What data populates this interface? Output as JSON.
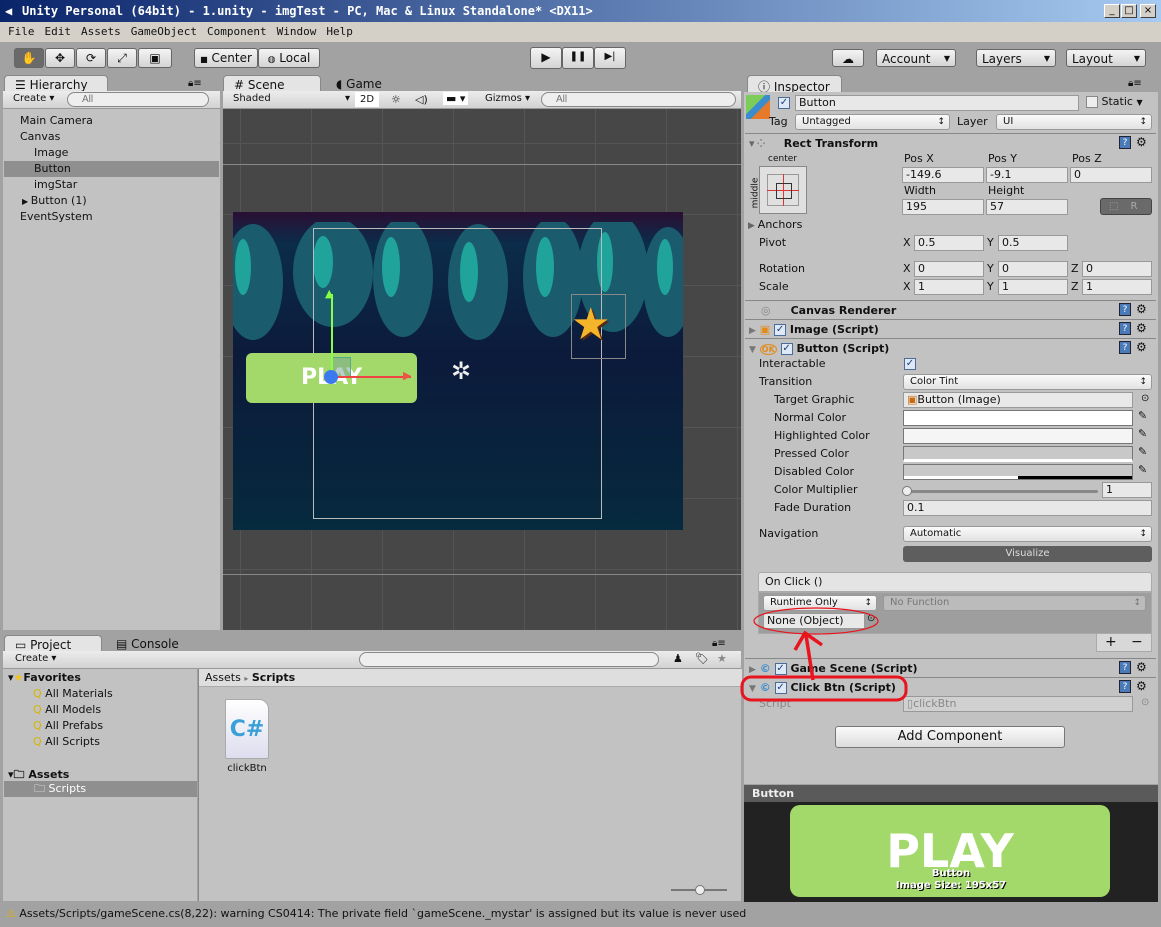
{
  "window": {
    "title": "Unity Personal (64bit) - 1.unity - imgTest - PC, Mac & Linux Standalone* <DX11>",
    "min": "_",
    "max": "□",
    "close": "×"
  },
  "menu": [
    "File",
    "Edit",
    "Assets",
    "GameObject",
    "Component",
    "Window",
    "Help"
  ],
  "toolbar": {
    "tools": [
      "hand-icon",
      "move-icon",
      "rotate-icon",
      "scale-icon",
      "rect-icon"
    ],
    "center": "Center",
    "local": "Local",
    "play": "▶",
    "pause": "❚❚",
    "step": "▶|",
    "cloud": "☁",
    "account": "Account",
    "layers": "Layers",
    "layout": "Layout"
  },
  "hierarchy": {
    "tab": "Hierarchy",
    "create": "Create",
    "search_placeholder": "All",
    "items": [
      {
        "label": "Main Camera",
        "indent": 0
      },
      {
        "label": "Canvas",
        "indent": 0
      },
      {
        "label": "Image",
        "indent": 1
      },
      {
        "label": "Button",
        "indent": 1,
        "selected": true
      },
      {
        "label": "imgStar",
        "indent": 1
      },
      {
        "label": "Button (1)",
        "indent": 1,
        "collapsed": true
      },
      {
        "label": "EventSystem",
        "indent": 0
      }
    ]
  },
  "scene": {
    "tab_scene": "Scene",
    "tab_game": "Game",
    "shading": "Shaded",
    "mode_2d": "2D",
    "gizmos": "Gizmos",
    "search_placeholder": "All",
    "play_text": "PLAY"
  },
  "project": {
    "tab_project": "Project",
    "tab_console": "Console",
    "create": "Create",
    "favorites": "Favorites",
    "fav_items": [
      "All Materials",
      "All Models",
      "All Prefabs",
      "All Scripts"
    ],
    "assets": "Assets",
    "folders": [
      "Scripts"
    ],
    "breadcrumb": [
      "Assets",
      "Scripts"
    ],
    "files": [
      {
        "name": "clickBtn",
        "type": "C#"
      }
    ]
  },
  "inspector": {
    "tab": "Inspector",
    "object_name": "Button",
    "static_label": "Static",
    "tag_label": "Tag",
    "tag": "Untagged",
    "layer_label": "Layer",
    "layer": "UI",
    "rect_transform": {
      "title": "Rect Transform",
      "anchor_h": "center",
      "anchor_v": "middle",
      "pos_x_label": "Pos X",
      "pos_y_label": "Pos Y",
      "pos_z_label": "Pos Z",
      "pos_x": "-149.6",
      "pos_y": "-9.1",
      "pos_z": "0",
      "width_label": "Width",
      "height_label": "Height",
      "width": "195",
      "height": "57",
      "r_label": "R",
      "anchors": "Anchors",
      "pivot": "Pivot",
      "pivot_x": "0.5",
      "pivot_y": "0.5",
      "rotation": "Rotation",
      "rot_x": "0",
      "rot_y": "0",
      "rot_z": "0",
      "scale": "Scale",
      "scale_x": "1",
      "scale_y": "1",
      "scale_z": "1",
      "x": "X",
      "y": "Y",
      "z": "Z"
    },
    "canvas_renderer": "Canvas Renderer",
    "image_script": "Image (Script)",
    "button_script": {
      "title": "Button (Script)",
      "interactable": "Interactable",
      "transition": "Transition",
      "transition_value": "Color Tint",
      "target_graphic": "Target Graphic",
      "target_graphic_value": "Button (Image)",
      "normal_color": "Normal Color",
      "highlighted_color": "Highlighted Color",
      "pressed_color": "Pressed Color",
      "disabled_color": "Disabled Color",
      "color_multiplier": "Color Multiplier",
      "color_multiplier_value": "1",
      "fade_duration": "Fade Duration",
      "fade_duration_value": "0.1",
      "navigation": "Navigation",
      "navigation_value": "Automatic",
      "visualize": "Visualize",
      "on_click": "On Click ()",
      "runtime": "Runtime Only",
      "function": "No Function",
      "object": "None (Object)",
      "plus": "+",
      "minus": "−"
    },
    "game_scene_script": "Game Scene (Script)",
    "click_btn_script": "Click Btn (Script)",
    "script_label": "Script",
    "script_value": "clickBtn",
    "add_component": "Add Component",
    "colors": {
      "normal": "#ffffff",
      "highlighted": "#f5f5f5",
      "pressed": "#c8c8c8",
      "disabled": "#c8c8c8",
      "annotation": "#e8141e"
    }
  },
  "preview": {
    "title": "Button",
    "play_text": "PLAY",
    "caption": "Button",
    "size": "Image Size: 195x57"
  },
  "status": {
    "message": "Assets/Scripts/gameScene.cs(8,22): warning CS0414: The private field `gameScene._mystar' is assigned but its value is never used"
  }
}
